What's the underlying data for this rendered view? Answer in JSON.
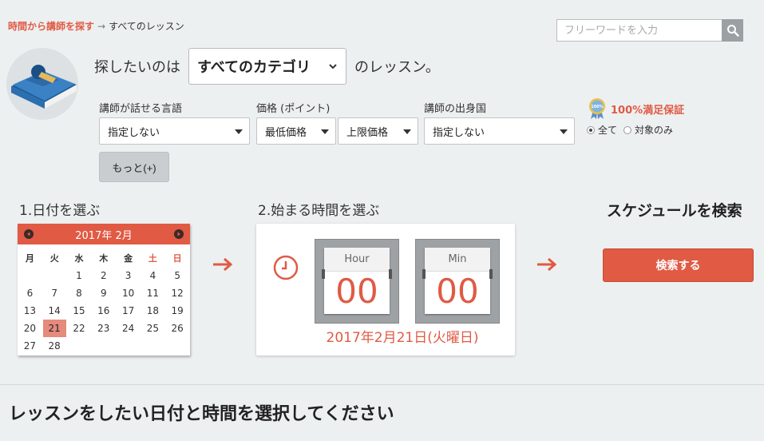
{
  "breadcrumb": {
    "link": "時間から講師を探す",
    "arrow": "→",
    "current": "すべてのレッスン"
  },
  "search": {
    "placeholder": "フリーワードを入力",
    "icon": "search-icon"
  },
  "headline": {
    "prefix": "探したいのは",
    "category_value": "すべてのカテゴリ",
    "suffix": "のレッスン。"
  },
  "filters": {
    "language": {
      "label": "講師が話せる言語",
      "value": "指定しない"
    },
    "price": {
      "label": "価格 (ポイント)",
      "min_value": "最低価格",
      "max_value": "上限価格"
    },
    "country": {
      "label": "講師の出身国",
      "value": "指定しない"
    }
  },
  "guarantee": {
    "title": "100%満足保証",
    "options": [
      "全て",
      "対象のみ"
    ],
    "selected": "全て"
  },
  "more_button": "もっと(+)",
  "step1": {
    "title": "1.日付を選ぶ"
  },
  "calendar": {
    "month_label": "2017年 2月",
    "weekdays": [
      "月",
      "火",
      "水",
      "木",
      "金",
      "土",
      "日"
    ],
    "leading_blanks": 2,
    "days": [
      "1",
      "2",
      "3",
      "4",
      "5",
      "6",
      "7",
      "8",
      "9",
      "10",
      "11",
      "12",
      "13",
      "14",
      "15",
      "16",
      "17",
      "18",
      "19",
      "20",
      "21",
      "22",
      "23",
      "24",
      "25",
      "26",
      "27",
      "28"
    ],
    "selected_day": "21",
    "weekend_color": "#e05a44"
  },
  "step2": {
    "title": "2.始まる時間を選ぶ"
  },
  "time": {
    "hour_label": "Hour",
    "hour_value": "00",
    "min_label": "Min",
    "min_value": "00",
    "date_readout": "2017年2月21日(火曜日)"
  },
  "search_section": {
    "title": "スケジュールを検索",
    "button": "検索する"
  },
  "prompt": "レッスンをしたい日付と時間を選択してください",
  "colors": {
    "accent": "#e05a44",
    "background": "#edf0f1"
  }
}
